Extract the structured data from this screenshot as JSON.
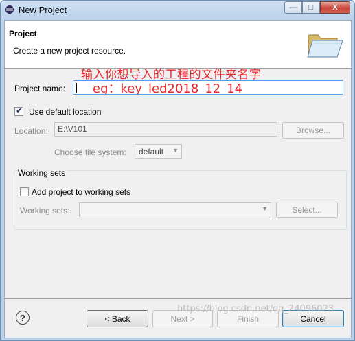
{
  "window": {
    "title": "New Project",
    "controls": {
      "minimize": "—",
      "maximize": "□",
      "close": "X"
    }
  },
  "banner": {
    "title": "Project",
    "description": "Create a new project resource.",
    "icon": "open-folder-icon"
  },
  "annotations": {
    "chinese_hint": "输入你想导入的工程的文件夹名字",
    "example": "eg：key_led2018_12_14"
  },
  "form": {
    "project_name_label": "Project name:",
    "project_name_value": "",
    "use_default_location_label": "Use default location",
    "use_default_location_checked": true,
    "location_label": "Location:",
    "location_value": "E:\\V101",
    "browse_label": "Browse...",
    "file_system_label": "Choose file system:",
    "file_system_value": "default"
  },
  "working_sets": {
    "group_title": "Working sets",
    "add_label": "Add project to working sets",
    "add_checked": false,
    "working_sets_label": "Working sets:",
    "working_sets_value": "",
    "select_label": "Select..."
  },
  "footer": {
    "help_icon": "?",
    "back_label": "< Back",
    "next_label": "Next >",
    "finish_label": "Finish",
    "cancel_label": "Cancel"
  },
  "watermark": "https://blog.csdn.net/qq_24096023"
}
